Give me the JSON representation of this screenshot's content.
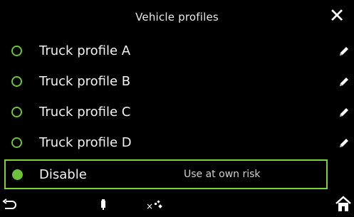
{
  "header": {
    "title": "Vehicle profiles",
    "close_icon": "close-icon"
  },
  "profiles": [
    {
      "label": "Truck profile A",
      "selected": false,
      "edit_icon": "pencil-icon"
    },
    {
      "label": "Truck profile B",
      "selected": false,
      "edit_icon": "pencil-icon"
    },
    {
      "label": "Truck profile C",
      "selected": false,
      "edit_icon": "pencil-icon"
    },
    {
      "label": "Truck profile D",
      "selected": false,
      "edit_icon": "pencil-icon"
    }
  ],
  "disable_option": {
    "label": "Disable",
    "note": "Use at own risk",
    "selected": true
  },
  "footer": {
    "icons": [
      "back-icon",
      "phone-battery-icon",
      "gps-signal-icon",
      "home-icon"
    ]
  },
  "colors": {
    "background": "#000000",
    "accent": "#7ed03a",
    "text": "#ffffff"
  }
}
